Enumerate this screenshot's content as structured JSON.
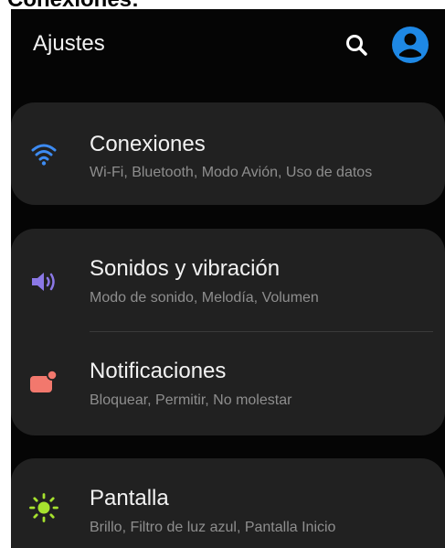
{
  "caption": "Conexiones:",
  "header": {
    "title": "Ajustes"
  },
  "items": [
    {
      "title": "Conexiones",
      "subtitle": "Wi-Fi, Bluetooth, Modo Avión, Uso de datos",
      "icon": "wifi-icon",
      "icon_color": "#3d8bf2"
    },
    {
      "title": "Sonidos y vibración",
      "subtitle": "Modo de sonido, Melodía, Volumen",
      "icon": "volume-icon",
      "icon_color": "#8b78e6"
    },
    {
      "title": "Notificaciones",
      "subtitle": "Bloquear, Permitir, No molestar",
      "icon": "notification-icon",
      "icon_color": "#f2786d"
    },
    {
      "title": "Pantalla",
      "subtitle": "Brillo, Filtro de luz azul, Pantalla Inicio",
      "icon": "brightness-icon",
      "icon_color": "#a6e22e"
    }
  ],
  "colors": {
    "background": "#050505",
    "card": "#212121",
    "accent": "#1e88e5"
  }
}
